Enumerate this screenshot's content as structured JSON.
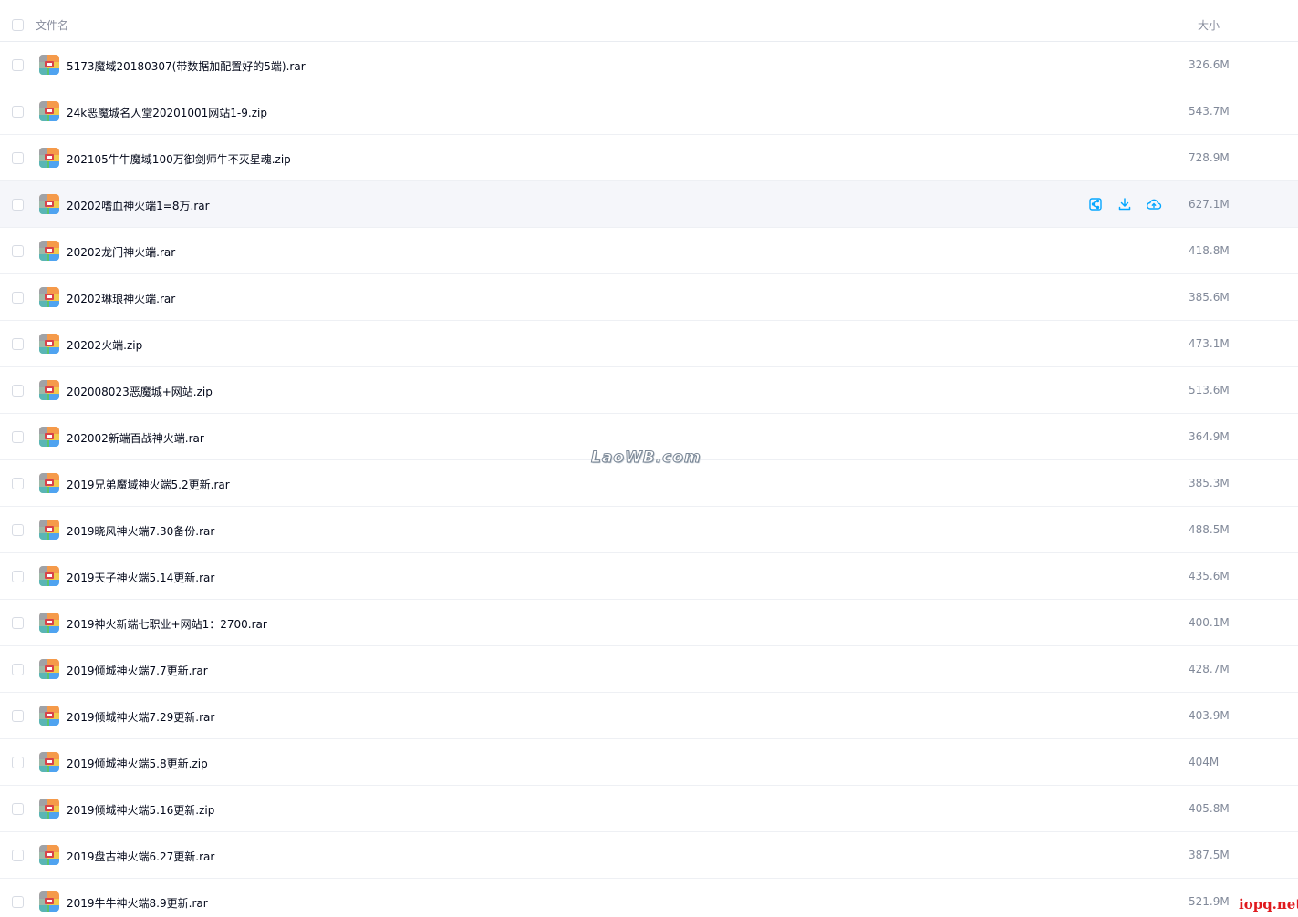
{
  "header": {
    "name_label": "文件名",
    "size_label": "大小"
  },
  "files": [
    {
      "name": "5173魔域20180307(带数据加配置好的5端).rar",
      "size": "326.6M"
    },
    {
      "name": "24k恶魔城名人堂20201001网站1-9.zip",
      "size": "543.7M"
    },
    {
      "name": "202105牛牛魔域100万御剑师牛不灭星魂.zip",
      "size": "728.9M"
    },
    {
      "name": "20202嗜血神火端1=8万.rar",
      "size": "627.1M"
    },
    {
      "name": "20202龙门神火端.rar",
      "size": "418.8M"
    },
    {
      "name": "20202琳琅神火端.rar",
      "size": "385.6M"
    },
    {
      "name": "20202火端.zip",
      "size": "473.1M"
    },
    {
      "name": "202008023恶魔城+网站.zip",
      "size": "513.6M"
    },
    {
      "name": "202002新端百战神火端.rar",
      "size": "364.9M"
    },
    {
      "name": "2019兄弟魔域神火端5.2更新.rar",
      "size": "385.3M"
    },
    {
      "name": "2019晓风神火端7.30备份.rar",
      "size": "488.5M"
    },
    {
      "name": "2019天子神火端5.14更新.rar",
      "size": "435.6M"
    },
    {
      "name": "2019神火新端七职业+网站1：2700.rar",
      "size": "400.1M"
    },
    {
      "name": "2019倾城神火端7.7更新.rar",
      "size": "428.7M"
    },
    {
      "name": "2019倾城神火端7.29更新.rar",
      "size": "403.9M"
    },
    {
      "name": "2019倾城神火端5.8更新.zip",
      "size": "404M"
    },
    {
      "name": "2019倾城神火端5.16更新.zip",
      "size": "405.8M"
    },
    {
      "name": "2019盘古神火端6.27更新.rar",
      "size": "387.5M"
    },
    {
      "name": "2019牛牛神火端8.9更新.rar",
      "size": "521.9M"
    }
  ],
  "hovered_row": 3,
  "row_actions": [
    "share-icon",
    "download-icon",
    "cloud-save-icon"
  ],
  "watermarks": {
    "center": "LaoWB.com",
    "corner": "iopq.net"
  },
  "colors": {
    "accent": "#06a7ff",
    "hover_row": "#f5f6fa",
    "corner_watermark": "#e0191d"
  }
}
